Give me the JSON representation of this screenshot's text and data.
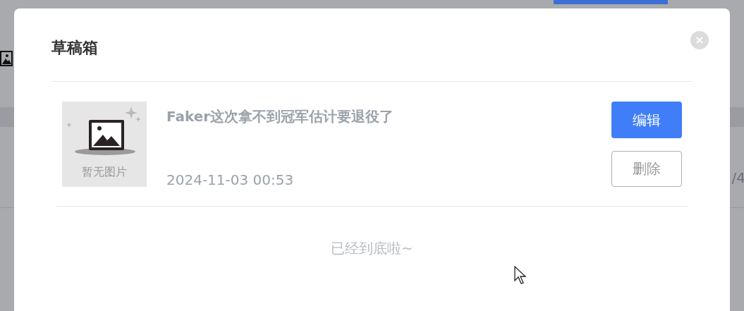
{
  "background_page": {
    "fragment_right": "/4"
  },
  "dialog": {
    "title": "草稿箱",
    "drafts": [
      {
        "thumbnail_caption": "暂无图片",
        "title": "Faker这次拿不到冠军估计要退役了",
        "date": "2024-11-03 00:53",
        "actions": [
          {
            "label": "编辑",
            "kind": "primary"
          },
          {
            "label": "删除",
            "kind": "outline"
          }
        ]
      }
    ],
    "end_message": "已经到底啦~"
  }
}
